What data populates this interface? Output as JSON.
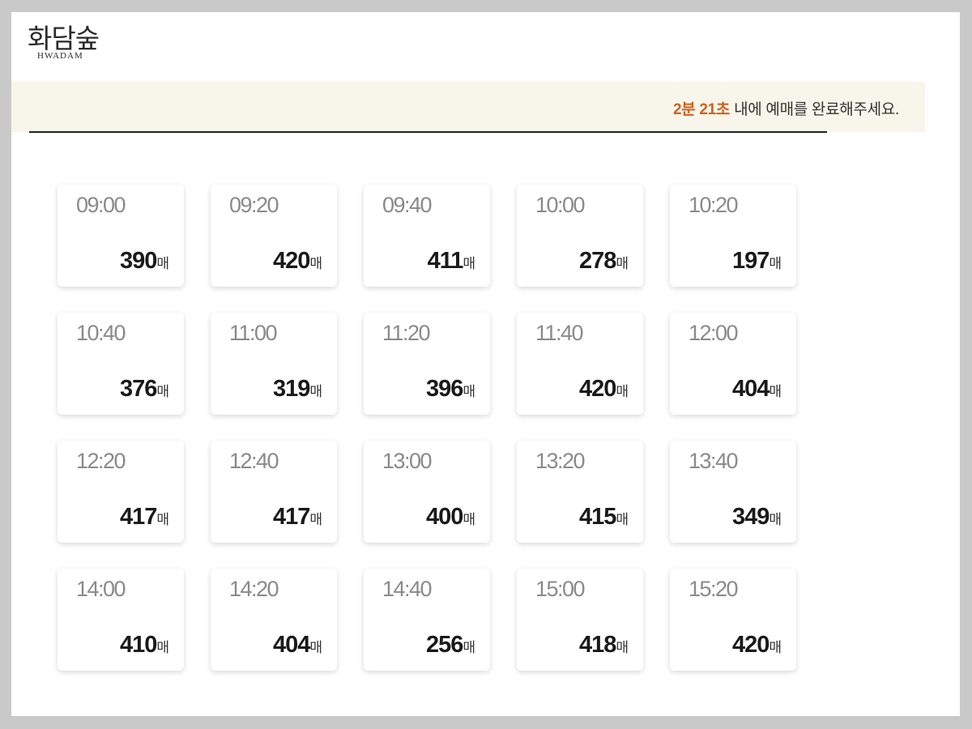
{
  "header": {
    "logo_korean": "화담숲",
    "logo_english": "HWADAM"
  },
  "banner": {
    "countdown": "2분 21초",
    "message": " 내에 예매를 완료해주세요."
  },
  "slot_unit": "매",
  "slots": [
    {
      "time": "09:00",
      "count": "390"
    },
    {
      "time": "09:20",
      "count": "420"
    },
    {
      "time": "09:40",
      "count": "411"
    },
    {
      "time": "10:00",
      "count": "278"
    },
    {
      "time": "10:20",
      "count": "197"
    },
    {
      "time": "10:40",
      "count": "376"
    },
    {
      "time": "11:00",
      "count": "319"
    },
    {
      "time": "11:20",
      "count": "396"
    },
    {
      "time": "11:40",
      "count": "420"
    },
    {
      "time": "12:00",
      "count": "404"
    },
    {
      "time": "12:20",
      "count": "417"
    },
    {
      "time": "12:40",
      "count": "417"
    },
    {
      "time": "13:00",
      "count": "400"
    },
    {
      "time": "13:20",
      "count": "415"
    },
    {
      "time": "13:40",
      "count": "349"
    },
    {
      "time": "14:00",
      "count": "410"
    },
    {
      "time": "14:20",
      "count": "404"
    },
    {
      "time": "14:40",
      "count": "256"
    },
    {
      "time": "15:00",
      "count": "418"
    },
    {
      "time": "15:20",
      "count": "420"
    }
  ]
}
